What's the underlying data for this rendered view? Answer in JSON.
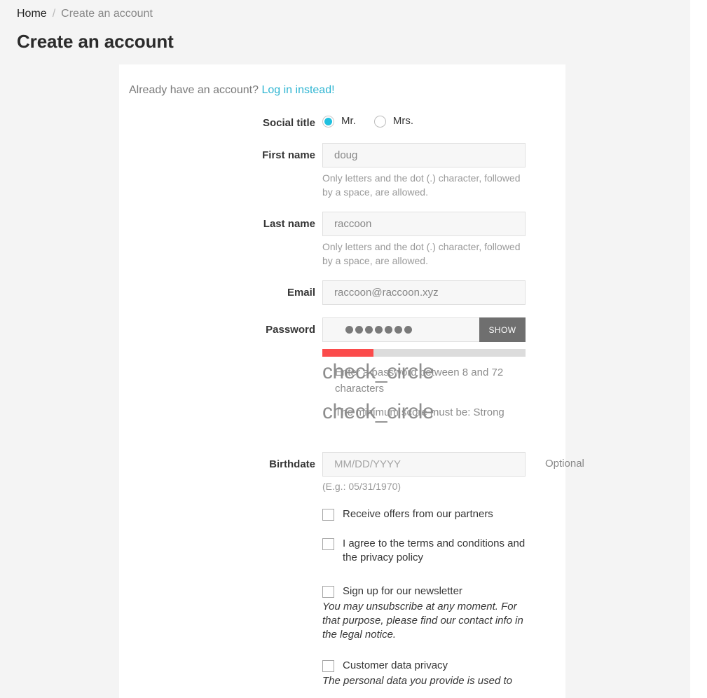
{
  "breadcrumb": {
    "home_label": "Home",
    "separator": "/",
    "current_label": "Create an account"
  },
  "page": {
    "title": "Create an account"
  },
  "card": {
    "login_prompt": "Already have an account?",
    "login_link": "Log in instead!"
  },
  "form": {
    "social_title": {
      "label": "Social title",
      "options": [
        {
          "label": "Mr.",
          "value": "1",
          "selected": true
        },
        {
          "label": "Mrs.",
          "value": "2",
          "selected": false
        }
      ]
    },
    "first_name": {
      "label": "First name",
      "value": "doug",
      "placeholder": "",
      "hint": "Only letters and the dot (.) character, followed by a space, are allowed."
    },
    "last_name": {
      "label": "Last name",
      "value": "raccoon",
      "placeholder": "",
      "hint": "Only letters and the dot (.) character, followed by a space, are allowed."
    },
    "email": {
      "label": "Email",
      "value": "raccoon@raccoon.xyz",
      "placeholder": ""
    },
    "password": {
      "label": "Password",
      "masked_value": "●●●●●●●",
      "dot_count": 7,
      "show_button_label": "SHOW",
      "strength_percent": 25,
      "strength_fill_color": "#fb4b4b",
      "strength_track_color": "#dcdcdc",
      "feedback": [
        {
          "icon_text": "check_circle",
          "text": "Enter a password between 8 and 72 characters"
        },
        {
          "icon_text": "check_circle",
          "text": "The minimum score must be: Strong"
        }
      ]
    },
    "birthdate": {
      "label": "Birthdate",
      "value": "",
      "placeholder": "MM/DD/YYYY",
      "hint": "(E.g.: 05/31/1970)",
      "optional_label": "Optional"
    },
    "checkboxes": [
      {
        "name": "partner-offers",
        "label": "Receive offers from our partners",
        "checked": false,
        "note": ""
      },
      {
        "name": "terms-and-conditions",
        "label": "I agree to the terms and conditions and the privacy policy",
        "checked": false,
        "note": ""
      },
      {
        "name": "newsletter",
        "label": "Sign up for our newsletter",
        "checked": false,
        "note": "You may unsubscribe at any moment. For that purpose, please find our contact info in the legal notice."
      },
      {
        "name": "customer-data-privacy",
        "label": "Customer data privacy",
        "checked": false,
        "note": "The personal data you provide is used to"
      }
    ]
  },
  "colors": {
    "accent": "#2fb5d2",
    "radio_fill": "#20c0df",
    "page_background": "#f4f4f4",
    "card_background": "#ffffff",
    "input_background": "#f7f7f7",
    "show_button_background": "#6f6f6f"
  }
}
